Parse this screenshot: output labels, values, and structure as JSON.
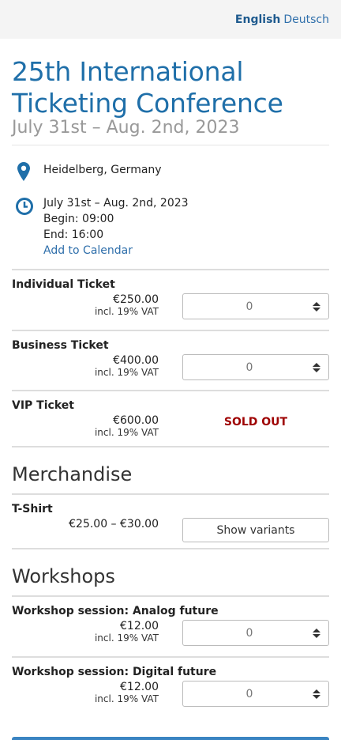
{
  "header": {
    "languages": [
      {
        "label": "English",
        "active": true
      },
      {
        "label": "Deutsch",
        "active": false
      }
    ]
  },
  "event": {
    "title_line1": "25th International",
    "title_line2": "Ticketing Conference",
    "dates": "July 31st – Aug. 2nd, 2023",
    "location": "Heidelberg, Germany",
    "date_detail": "July 31st – Aug. 2nd, 2023",
    "begin": "Begin: 09:00",
    "end": "End: 16:00",
    "calendar_link": "Add to Calendar"
  },
  "tickets": [
    {
      "name": "Individual Ticket",
      "price": "€250.00",
      "vat": "incl. 19% VAT",
      "qty": "0"
    },
    {
      "name": "Business Ticket",
      "price": "€400.00",
      "vat": "incl. 19% VAT",
      "qty": "0"
    },
    {
      "name": "VIP Ticket",
      "price": "€600.00",
      "vat": "incl. 19% VAT",
      "status": "SOLD OUT"
    }
  ],
  "merchandise": {
    "title": "Merchandise",
    "items": [
      {
        "name": "T-Shirt",
        "price_range": "€25.00 – €30.00",
        "button": "Show variants"
      }
    ]
  },
  "workshops": {
    "title": "Workshops",
    "items": [
      {
        "name": "Workshop session: Analog future",
        "price": "€12.00",
        "vat": "incl. 19% VAT",
        "qty": "0"
      },
      {
        "name": "Workshop session: Digital future",
        "price": "€12.00",
        "vat": "incl. 19% VAT",
        "qty": "0"
      }
    ]
  },
  "colors": {
    "brand_blue": "#1f6fa9",
    "link_blue": "#2f6fab",
    "sold_out_red": "#9e0000"
  }
}
